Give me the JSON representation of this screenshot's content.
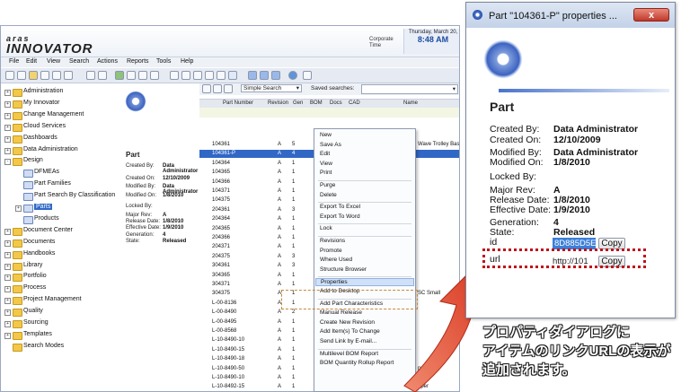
{
  "app": {
    "logo_top": "aras",
    "logo_main": "INNOVATOR",
    "corporate_time_label": "Corporate Time",
    "clock_date": "Thursday, March 20,",
    "clock_time": "8:48 AM"
  },
  "menu": [
    "File",
    "Edit",
    "View",
    "Search",
    "Actions",
    "Reports",
    "Tools",
    "Help"
  ],
  "tree": {
    "items": [
      {
        "label": "Administration",
        "indent": 0,
        "expander": "+"
      },
      {
        "label": "My Innovator",
        "indent": 0,
        "expander": "+"
      },
      {
        "label": "Change Management",
        "indent": 0,
        "expander": "+"
      },
      {
        "label": "Cloud Services",
        "indent": 0,
        "expander": "+"
      },
      {
        "label": "Dashboards",
        "indent": 0,
        "expander": "+"
      },
      {
        "label": "Data Administration",
        "indent": 0,
        "expander": "+"
      },
      {
        "label": "Design",
        "indent": 0,
        "expander": "-"
      },
      {
        "label": "DFMEAs",
        "indent": 1,
        "expander": ""
      },
      {
        "label": "Part Families",
        "indent": 1,
        "expander": ""
      },
      {
        "label": "Part Search By Classification",
        "indent": 1,
        "expander": ""
      },
      {
        "label": "Parts",
        "indent": 1,
        "expander": "+",
        "selected": true
      },
      {
        "label": "Products",
        "indent": 1,
        "expander": ""
      },
      {
        "label": "Document Center",
        "indent": 0,
        "expander": "+"
      },
      {
        "label": "Documents",
        "indent": 0,
        "expander": "+"
      },
      {
        "label": "Handbooks",
        "indent": 0,
        "expander": "+"
      },
      {
        "label": "Library",
        "indent": 0,
        "expander": "+"
      },
      {
        "label": "Portfolio",
        "indent": 0,
        "expander": "+"
      },
      {
        "label": "Process",
        "indent": 0,
        "expander": "+"
      },
      {
        "label": "Project Management",
        "indent": 0,
        "expander": "+"
      },
      {
        "label": "Quality",
        "indent": 0,
        "expander": "+"
      },
      {
        "label": "Sourcing",
        "indent": 0,
        "expander": "+"
      },
      {
        "label": "Templates",
        "indent": 0,
        "expander": "+"
      },
      {
        "label": "Search Modes",
        "indent": 0,
        "expander": ""
      }
    ]
  },
  "details": {
    "title": "Part",
    "rows": [
      {
        "label": "Created By:",
        "value": "Data Administrator"
      },
      {
        "label": "Created On:",
        "value": "12/10/2009"
      },
      {
        "label": "Modified By:",
        "value": "Data Administrator"
      },
      {
        "label": "Modified On:",
        "value": "1/8/2010"
      },
      {
        "label": "Locked By:",
        "value": ""
      },
      {
        "label": "Major Rev:",
        "value": "A"
      },
      {
        "label": "Release Date:",
        "value": "1/8/2010"
      },
      {
        "label": "Effective Date:",
        "value": "1/9/2010"
      },
      {
        "label": "Generation:",
        "value": "4"
      },
      {
        "label": "State:",
        "value": "Released"
      }
    ]
  },
  "grid": {
    "search_mode": "Simple Search",
    "saved_searches_label": "Saved searches:",
    "columns": [
      "Part Number",
      "Revision",
      "Gen",
      "BOM",
      "Docs",
      "CAD",
      "Name"
    ],
    "rows": [
      {
        "pn": "104361",
        "rev": "A",
        "gen": "5",
        "name": "Wave Trolley Base"
      },
      {
        "pn": "104361-P",
        "rev": "A",
        "gen": "4",
        "name": "",
        "selected": true
      },
      {
        "pn": "104364",
        "rev": "A",
        "gen": "1",
        "name": ""
      },
      {
        "pn": "104365",
        "rev": "A",
        "gen": "1",
        "name": ""
      },
      {
        "pn": "104366",
        "rev": "A",
        "gen": "1",
        "name": ""
      },
      {
        "pn": "104371",
        "rev": "A",
        "gen": "1",
        "name": ""
      },
      {
        "pn": "104375",
        "rev": "A",
        "gen": "1",
        "name": ""
      },
      {
        "pn": "204361",
        "rev": "A",
        "gen": "3",
        "name": ""
      },
      {
        "pn": "204364",
        "rev": "A",
        "gen": "1",
        "name": ""
      },
      {
        "pn": "204365",
        "rev": "A",
        "gen": "1",
        "name": ""
      },
      {
        "pn": "204366",
        "rev": "A",
        "gen": "1",
        "name": ""
      },
      {
        "pn": "204371",
        "rev": "A",
        "gen": "1",
        "name": ""
      },
      {
        "pn": "204375",
        "rev": "A",
        "gen": "3",
        "name": ""
      },
      {
        "pn": "304361",
        "rev": "A",
        "gen": "3",
        "name": ""
      },
      {
        "pn": "304365",
        "rev": "A",
        "gen": "1",
        "name": ""
      },
      {
        "pn": "304371",
        "rev": "A",
        "gen": "1",
        "name": ""
      },
      {
        "pn": "304375",
        "rev": "A",
        "gen": "1",
        "name": "SC Small"
      },
      {
        "pn": "L-00-8136",
        "rev": "A",
        "gen": "1",
        "name": ""
      },
      {
        "pn": "L-00-8490",
        "rev": "A",
        "gen": "2",
        "name": ""
      },
      {
        "pn": "L-00-8495",
        "rev": "A",
        "gen": "1",
        "name": ""
      },
      {
        "pn": "L-00-8568",
        "rev": "A",
        "gen": "1",
        "name": ""
      },
      {
        "pn": "L-10-8490-10",
        "rev": "A",
        "gen": "1",
        "name": ""
      },
      {
        "pn": "L-10-8490-15",
        "rev": "A",
        "gen": "1",
        "name": ""
      },
      {
        "pn": "L-10-8490-18",
        "rev": "A",
        "gen": "1",
        "name": ""
      },
      {
        "pn": "L-10-8490-50",
        "rev": "A",
        "gen": "1",
        "name": "pper"
      },
      {
        "pn": "L-10-8490-10",
        "rev": "A",
        "gen": "1",
        "name": "pper"
      },
      {
        "pn": "L-10-8492-15",
        "rev": "A",
        "gen": "1",
        "name": "pper"
      }
    ]
  },
  "context_menu": {
    "items": [
      {
        "label": "New"
      },
      {
        "label": "Save As"
      },
      {
        "label": "Edit"
      },
      {
        "label": "View"
      },
      {
        "label": "Print"
      },
      {
        "label": "Purge"
      },
      {
        "label": "Delete"
      },
      {
        "label": "Export To Excel"
      },
      {
        "label": "Export To Word"
      },
      {
        "label": "Lock"
      },
      {
        "label": "Revisions"
      },
      {
        "label": "Promote"
      },
      {
        "label": "Where Used"
      },
      {
        "label": "Structure Browser"
      },
      {
        "label": "Properties",
        "highlight": true
      },
      {
        "label": "Add to Desktop"
      },
      {
        "label": "Add Part Characteristics"
      },
      {
        "label": "Manual Release"
      },
      {
        "label": "Create New Revision"
      },
      {
        "label": "Add Item(s) To Change"
      },
      {
        "label": "Send Link by E-mail..."
      },
      {
        "label": "Multilevel BOM Report"
      },
      {
        "label": "BOM Quantity Rollup Report"
      }
    ]
  },
  "dialog": {
    "title": "Part \"104361-P\" properties ...",
    "close_glyph": "x",
    "heading": "Part",
    "rows": [
      {
        "label": "Created By:",
        "value": "Data Administrator"
      },
      {
        "label": "Created On:",
        "value": "12/10/2009"
      },
      {
        "label": "Modified By:",
        "value": "Data Administrator"
      },
      {
        "label": "Modified On:",
        "value": "1/8/2010"
      },
      {
        "label": "Locked By:",
        "value": ""
      },
      {
        "label": "Major Rev:",
        "value": "A"
      },
      {
        "label": "Release Date:",
        "value": "1/8/2010"
      },
      {
        "label": "Effective Date:",
        "value": "1/9/2010"
      },
      {
        "label": "Generation:",
        "value": "4"
      },
      {
        "label": "State:",
        "value": "Released"
      }
    ],
    "id_label": "id",
    "id_value": "8D885D5E",
    "url_label": "url",
    "url_value": "http://101",
    "copy_label": "Copy"
  },
  "annotation": {
    "lines": [
      "プロパティダイアログに",
      "アイテムのリンクURLの表示が",
      "追加されます。"
    ]
  },
  "colors": {
    "selection": "#3168c6",
    "highlight_box": "#c0101a",
    "arrow": "#e0442e"
  }
}
